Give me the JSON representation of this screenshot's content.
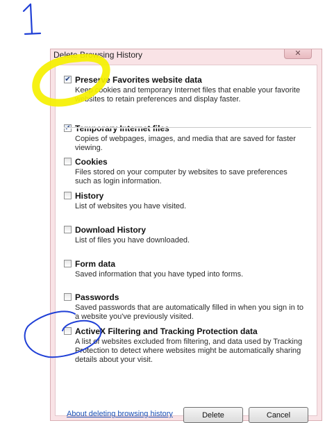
{
  "annotation": {
    "step_number": "1"
  },
  "dialog": {
    "title": "Delete Browsing History",
    "close_glyph": "✕",
    "items": [
      {
        "title": "Preserve Favorites website data",
        "checked": true,
        "description": "Keep cookies and temporary Internet files that enable your favorite websites to retain preferences and display faster."
      },
      {
        "title": "Temporary Internet files",
        "checked": true,
        "description": "Copies of webpages, images, and media that are saved for faster viewing."
      },
      {
        "title": "Cookies",
        "checked": false,
        "description": "Files stored on your computer by websites to save preferences such as login information."
      },
      {
        "title": "History",
        "checked": false,
        "description": "List of websites you have visited."
      },
      {
        "title": "Download History",
        "checked": false,
        "description": "List of files you have downloaded."
      },
      {
        "title": "Form data",
        "checked": false,
        "description": "Saved information that you have typed into forms."
      },
      {
        "title": "Passwords",
        "checked": false,
        "description": "Saved passwords that are automatically filled in when you sign in to a website you've previously visited."
      },
      {
        "title": "ActiveX Filtering and Tracking Protection data",
        "checked": false,
        "description": "A list of websites excluded from filtering, and data used by Tracking Protection to detect where websites might be automatically sharing details about your visit."
      }
    ],
    "footer_link": "About deleting browsing history",
    "delete_label": "Delete",
    "cancel_label": "Cancel"
  },
  "colors": {
    "highlight_yellow": "#f5f000",
    "pen_blue": "#1f3fd6",
    "frame": "#f9e3e6",
    "link": "#1a50b5"
  }
}
